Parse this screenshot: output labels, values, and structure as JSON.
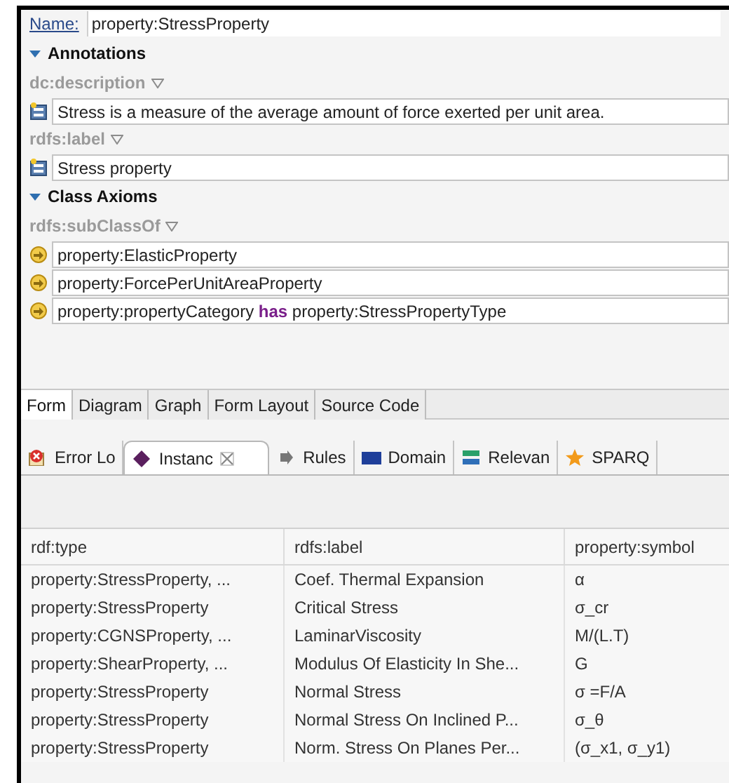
{
  "name_field": {
    "label": "Name:",
    "value": "property:StressProperty"
  },
  "sections": [
    {
      "title": "Annotations",
      "expanded": true,
      "properties": [
        {
          "label": "dc:description",
          "kind": "annotation",
          "values": [
            "Stress is a measure of the average amount of force exerted per unit area."
          ]
        },
        {
          "label": "rdfs:label",
          "kind": "annotation",
          "values": [
            "Stress property"
          ]
        }
      ]
    },
    {
      "title": "Class Axioms",
      "expanded": true,
      "properties": [
        {
          "label": "rdfs:subClassOf",
          "kind": "class",
          "values": [
            "property:ElasticProperty",
            "property:ForcePerUnitAreaProperty",
            "property:propertyCategory **has** property:StressPropertyType"
          ]
        }
      ]
    }
  ],
  "editor_tabs": [
    {
      "label": "Form",
      "selected": true
    },
    {
      "label": "Diagram",
      "selected": false
    },
    {
      "label": "Graph",
      "selected": false
    },
    {
      "label": "Form Layout",
      "selected": false
    },
    {
      "label": "Source Code",
      "selected": false
    }
  ],
  "view_tabs": [
    {
      "label": "Error Lo",
      "kind": "error",
      "selected": false
    },
    {
      "label": "Instanc",
      "kind": "instance",
      "selected": true
    },
    {
      "label": "Rules",
      "kind": "rules",
      "selected": false
    },
    {
      "label": "Domain",
      "kind": "domain",
      "selected": false
    },
    {
      "label": "Relevan",
      "kind": "relevance",
      "selected": false
    },
    {
      "label": "SPARQ",
      "kind": "sparql",
      "selected": false
    }
  ],
  "table": {
    "columns": [
      "rdf:type",
      "rdfs:label",
      "property:symbol"
    ],
    "rows": [
      [
        "property:StressProperty, ...",
        "Coef. Thermal Expansion",
        "α"
      ],
      [
        "property:StressProperty",
        "Critical Stress",
        "σ_cr"
      ],
      [
        "property:CGNSProperty, ...",
        "LaminarViscosity",
        "M/(L.T)"
      ],
      [
        "property:ShearProperty, ...",
        "Modulus Of Elasticity In She...",
        "G"
      ],
      [
        "property:StressProperty",
        "Normal Stress",
        "σ =F/A"
      ],
      [
        "property:StressProperty",
        "Normal Stress On Inclined P...",
        "σ_θ"
      ],
      [
        "property:StressProperty",
        "Norm. Stress On Planes Per...",
        "(σ_x1, σ_y1)"
      ]
    ]
  }
}
